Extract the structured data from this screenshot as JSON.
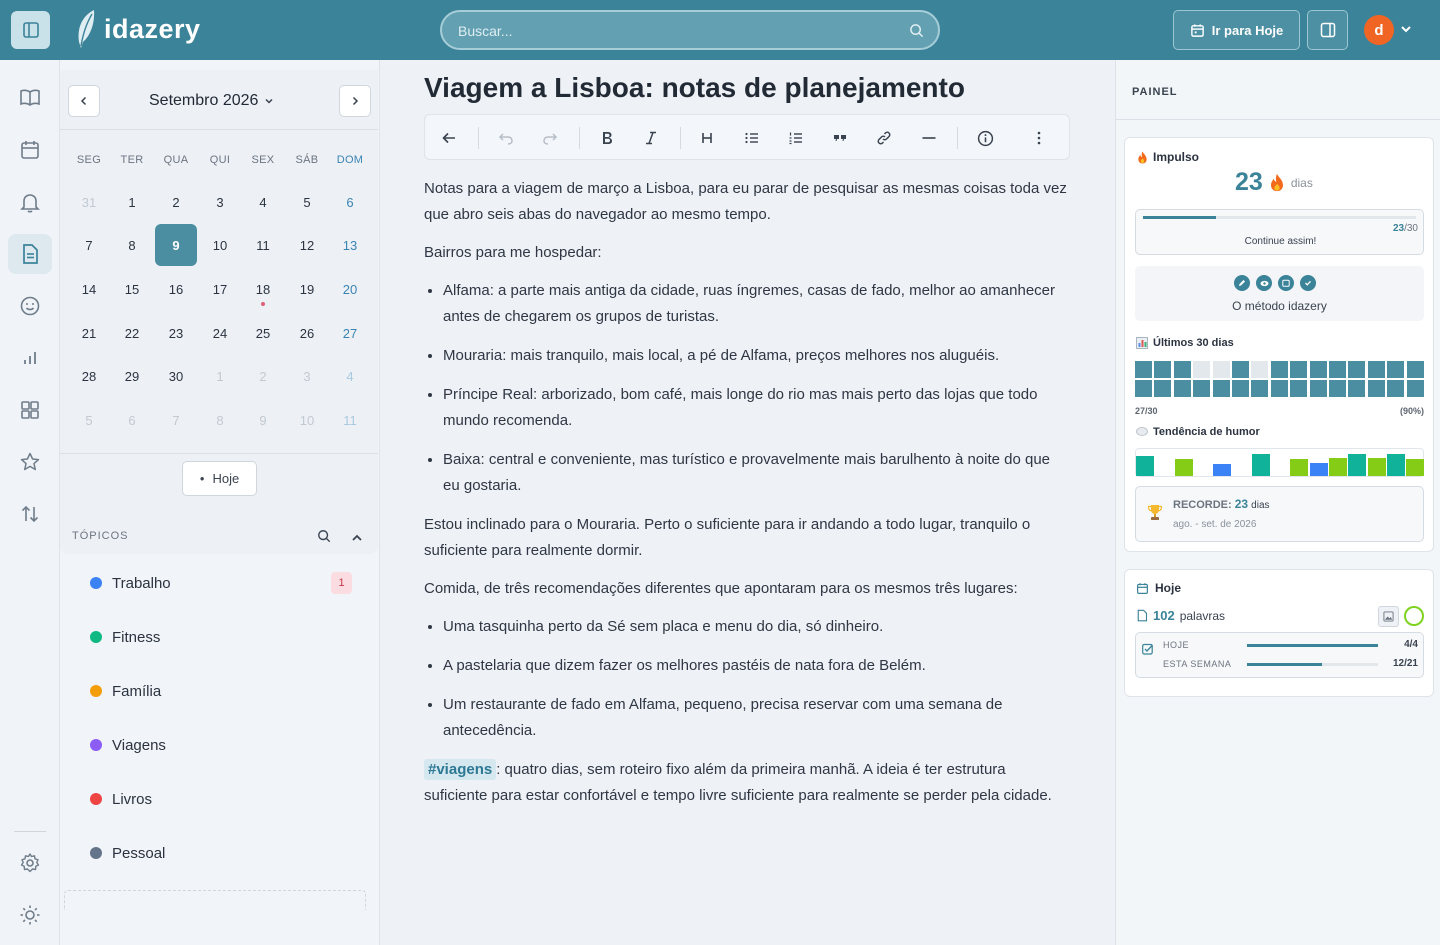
{
  "app": {
    "name": "idazery"
  },
  "header": {
    "search_placeholder": "Buscar...",
    "today_button": "Ir para Hoje",
    "avatar_initial": "d"
  },
  "calendar": {
    "month_label": "Setembro 2026",
    "dow": [
      "SEG",
      "TER",
      "QUA",
      "QUI",
      "SEX",
      "SÁB",
      "DOM"
    ],
    "weeks": [
      [
        "31",
        "1",
        "2",
        "3",
        "4",
        "5",
        "6"
      ],
      [
        "7",
        "8",
        "9",
        "10",
        "11",
        "12",
        "13"
      ],
      [
        "14",
        "15",
        "16",
        "17",
        "18",
        "19",
        "20"
      ],
      [
        "21",
        "22",
        "23",
        "24",
        "25",
        "26",
        "27"
      ],
      [
        "28",
        "29",
        "30",
        "1",
        "2",
        "3",
        "4"
      ],
      [
        "5",
        "6",
        "7",
        "8",
        "9",
        "10",
        "11"
      ]
    ],
    "selected_day": "9",
    "today_button": "Hoje"
  },
  "topics": {
    "title": "TÓPICOS",
    "items": [
      {
        "label": "Trabalho",
        "color": "#3b82f6",
        "badge": "1"
      },
      {
        "label": "Fitness",
        "color": "#10b981"
      },
      {
        "label": "Família",
        "color": "#f59e0b"
      },
      {
        "label": "Viagens",
        "color": "#8b5cf6"
      },
      {
        "label": "Livros",
        "color": "#ef4444"
      },
      {
        "label": "Pessoal",
        "color": "#64748b"
      }
    ]
  },
  "document": {
    "title": "Viagem a Lisboa: notas de planejamento",
    "intro": "Notas para a viagem de março a Lisboa, para eu parar de pesquisar as mesmas coisas toda vez que abro seis abas do navegador ao mesmo tempo.",
    "bairros_heading": "Bairros para me hospedar:",
    "bairros": [
      {
        "name": "Alfama",
        "text": ": a parte mais antiga da cidade, ruas íngremes, casas de fado, melhor ao amanhecer antes de chegarem os grupos de turistas."
      },
      {
        "name": "Mouraria",
        "text": ": mais tranquilo, mais local, a pé de Alfama, preços melhores nos aluguéis."
      },
      {
        "name": "Príncipe Real",
        "text": ": arborizado, bom café, mais longe do rio mas mais perto das lojas que todo mundo recomenda."
      },
      {
        "name": "Baixa",
        "text": ": central e conveniente, mas turístico e provavelmente mais barulhento à noite do que eu gostaria."
      }
    ],
    "mouraria_note": "Estou inclinado para o Mouraria. Perto o suficiente para ir andando a todo lugar, tranquilo o suficiente para realmente dormir.",
    "comida_heading": "Comida, de três recomendações diferentes que apontaram para os mesmos três lugares:",
    "comida": [
      "Uma tasquinha perto da Sé sem placa e menu do dia, só dinheiro.",
      "A pastelaria que dizem fazer os melhores pastéis de nata fora de Belém.",
      "Um restaurante de fado em Alfama, pequeno, precisa reservar com uma semana de antecedência."
    ],
    "tag": "#viagens",
    "closing": ": quatro dias, sem roteiro fixo além da primeira manhã. A ideia é ter estrutura suficiente para estar confortável e tempo livre suficiente para realmente se perder pela cidade."
  },
  "panel": {
    "title": "PAINEL",
    "impulso": {
      "label": "Impulso",
      "days": "23",
      "days_unit": "dias",
      "progress_value": "23",
      "progress_total": "/30",
      "progress_fraction": 0.2667,
      "message": "Continue assim!"
    },
    "method_label": "O método idazery",
    "last30": {
      "label": "Últimos 30 dias",
      "count": "27/30",
      "percent": "(90%)",
      "cells": [
        1,
        1,
        1,
        0,
        0,
        1,
        0,
        1,
        1,
        1,
        1,
        1,
        1,
        1,
        1,
        1,
        1,
        1,
        1,
        1,
        1,
        1,
        1,
        1,
        1,
        1,
        1,
        1,
        1,
        1
      ]
    },
    "mood": {
      "label": "Tendência de humor",
      "bars": [
        {
          "level": 0.85,
          "color": "#10b39a"
        },
        {
          "level": 0,
          "color": "#10b39a"
        },
        {
          "level": 0.7,
          "color": "#84cc16"
        },
        {
          "level": 0,
          "color": "#10b39a"
        },
        {
          "level": 0.5,
          "color": "#3b82f6"
        },
        {
          "level": 0,
          "color": "#10b39a"
        },
        {
          "level": 0.9,
          "color": "#10b39a"
        },
        {
          "level": 0,
          "color": "#10b39a"
        },
        {
          "level": 0.7,
          "color": "#84cc16"
        },
        {
          "level": 0.55,
          "color": "#3b82f6"
        },
        {
          "level": 0.75,
          "color": "#84cc16"
        },
        {
          "level": 0.9,
          "color": "#10b39a"
        },
        {
          "level": 0.75,
          "color": "#84cc16"
        },
        {
          "level": 0.9,
          "color": "#10b39a"
        },
        {
          "level": 0.7,
          "color": "#84cc16"
        }
      ]
    },
    "record": {
      "label": "RECORDE:",
      "value": "23",
      "unit": "dias",
      "period": "ago. - set. de 2026"
    },
    "today": {
      "label": "Hoje",
      "words_value": "102",
      "words_unit": "palavras",
      "hoje_label": "HOJE",
      "hoje_value": "4/4",
      "hoje_fraction": 1.0,
      "week_label": "ESTA SEMANA",
      "week_value": "12/21",
      "week_fraction": 0.571
    }
  }
}
